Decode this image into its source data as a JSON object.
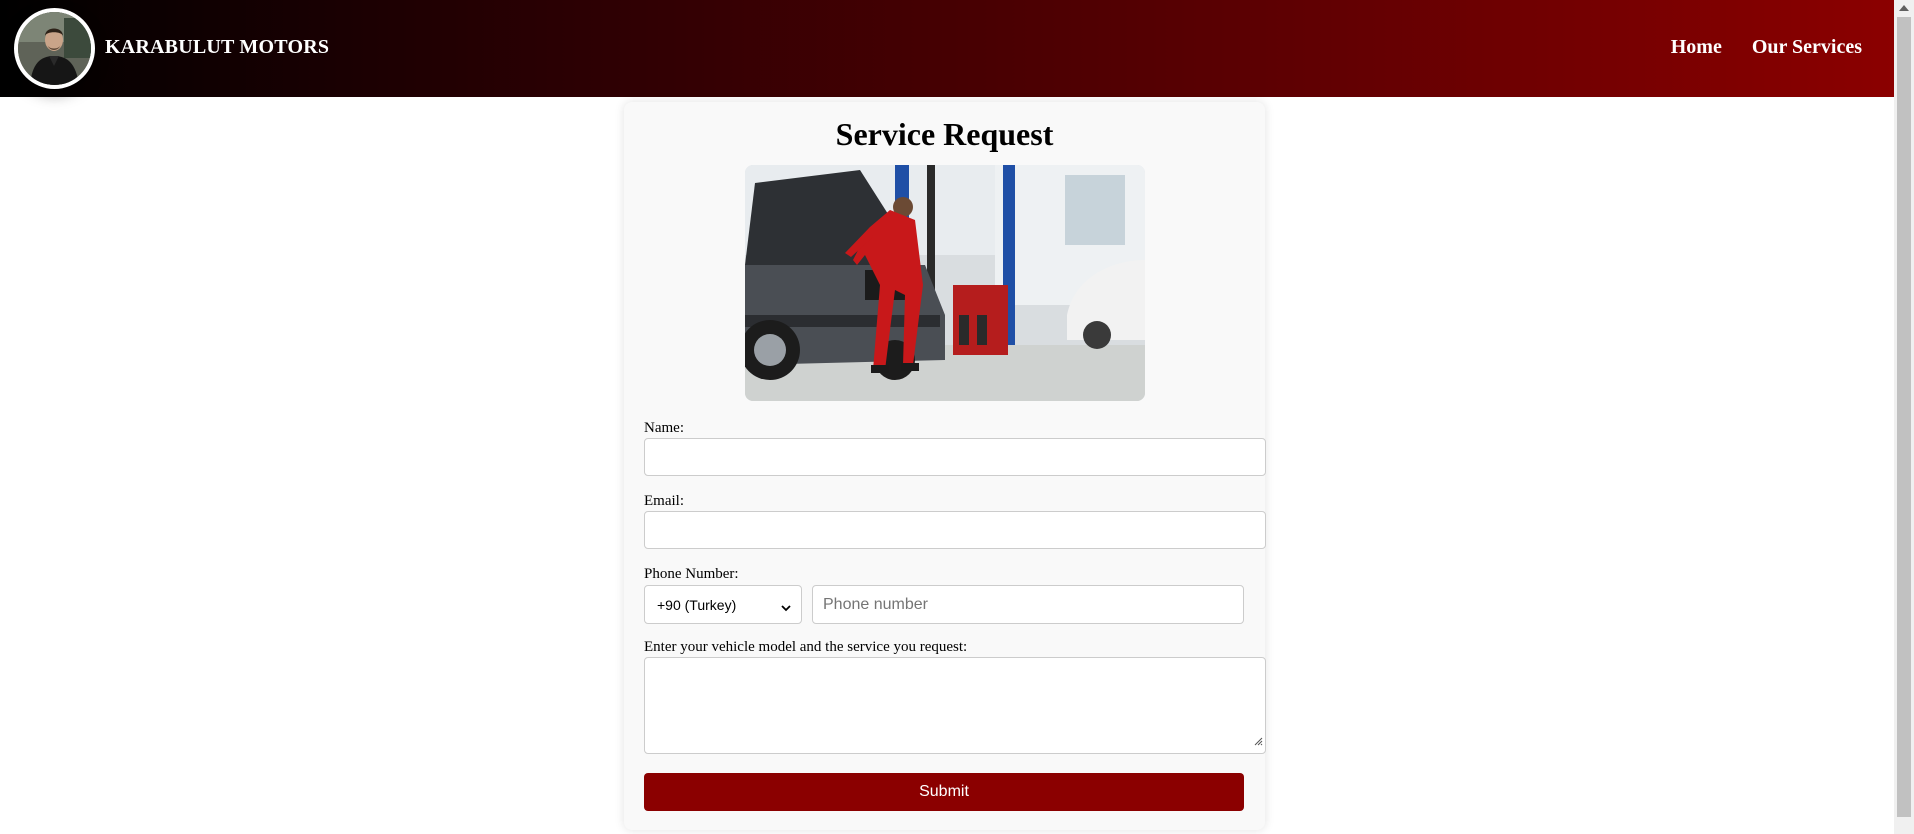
{
  "header": {
    "brand": "KARABULUT MOTORS",
    "nav": [
      {
        "label": "Home"
      },
      {
        "label": "Our Services"
      }
    ],
    "gradient_start": "#000000",
    "gradient_end": "#8b0000"
  },
  "form": {
    "title": "Service Request",
    "name_label": "Name:",
    "name_value": "",
    "email_label": "Email:",
    "email_value": "",
    "phone_label": "Phone Number:",
    "country_code": "+90 (Turkey)",
    "phone_placeholder": "Phone number",
    "request_label": "Enter your vehicle model and the service you request:",
    "request_value": "",
    "submit_label": "Submit",
    "accent_color": "#8b0000"
  }
}
